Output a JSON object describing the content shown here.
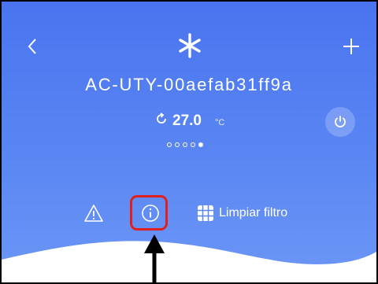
{
  "header": {
    "back_icon": "chevron-left-icon",
    "mode_icon": "snowflake-icon",
    "add_icon": "plus-icon"
  },
  "device": {
    "name": "AC-UTY-00aefab31ff9a"
  },
  "temperature": {
    "arrow_icon": "cycle-arrow-icon",
    "value": "27.0",
    "unit": "°C"
  },
  "power": {
    "icon": "power-icon"
  },
  "pagination": {
    "total": 5,
    "active_index": 4
  },
  "actions": {
    "warning_icon": "warning-icon",
    "info_icon": "info-icon",
    "filter_icon": "filter-grid-icon",
    "filter_label": "Limpiar filtro"
  },
  "colors": {
    "background_top": "#4a74ef",
    "background_bottom": "#6c97f6",
    "highlight": "#e02020",
    "arrow": "#000000"
  }
}
